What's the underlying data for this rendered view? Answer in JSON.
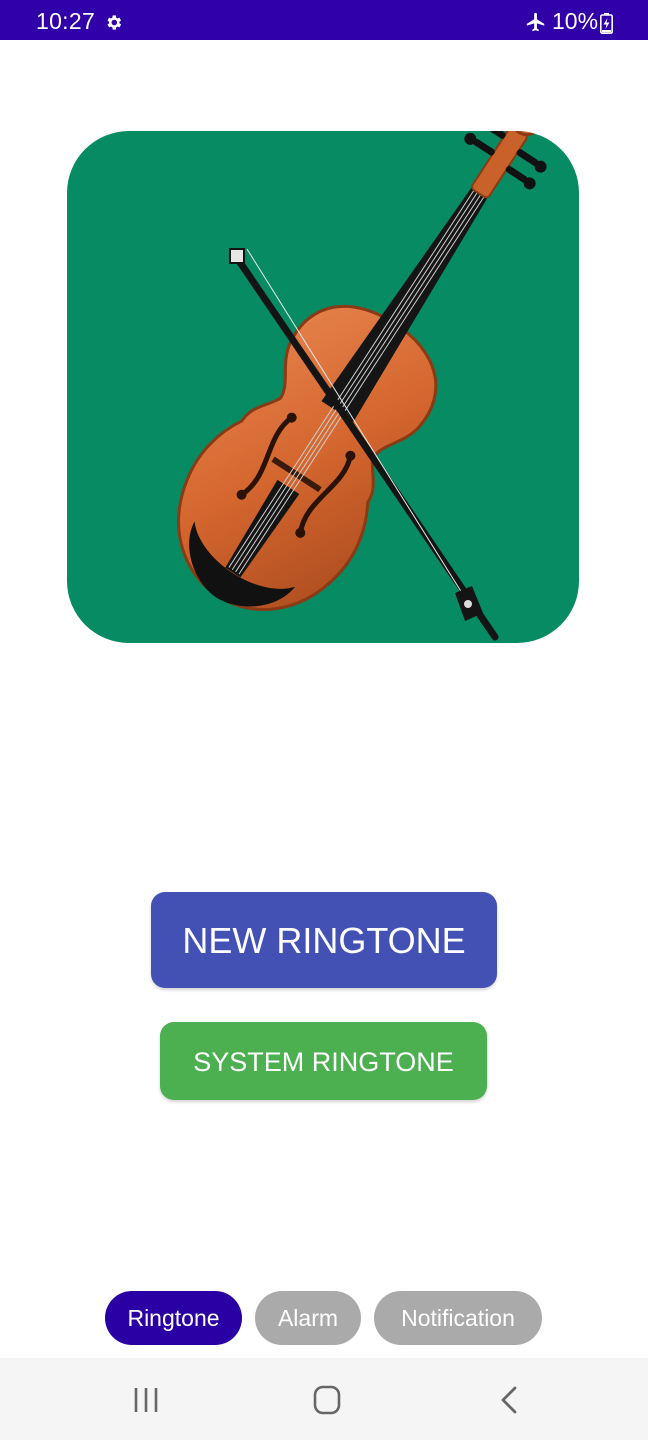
{
  "status_bar": {
    "time": "10:27",
    "battery": "10%",
    "icons": [
      "gear-icon",
      "airplane-icon",
      "battery-charging-icon"
    ]
  },
  "hero_image": {
    "subject": "violin-with-bow",
    "background_color": "#068b63"
  },
  "buttons": {
    "new_ringtone": "NEW RINGTONE",
    "system_ringtone": "SYSTEM RINGTONE"
  },
  "categories": {
    "ringtone": "Ringtone",
    "alarm": "Alarm",
    "notification": "Notification",
    "selected": "Ringtone"
  },
  "nav_bar": {
    "icons": [
      "recent-apps-icon",
      "home-icon",
      "back-icon"
    ]
  },
  "colors": {
    "status_bar": "#3000a8",
    "new_ringtone_button": "#4351b5",
    "system_ringtone_button": "#4caf50",
    "selected_chip": "#2a00a5",
    "unselected_chip": "#aaaaaa"
  }
}
